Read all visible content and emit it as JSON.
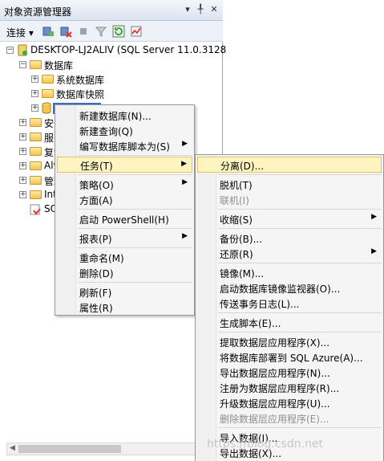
{
  "panel": {
    "title": "对象资源管理器",
    "pin": "▾ ╀",
    "close": "✕"
  },
  "toolbar": {
    "connect_label": "连接"
  },
  "tree": {
    "root": "DESKTOP-LJ2ALIV (SQL Server 11.0.3128",
    "databases": "数据库",
    "system_databases": "系统数据库",
    "db_snapshots": "数据库快照",
    "selected_db": "",
    "security": "安全",
    "server_objects": "服务",
    "replication": "复制",
    "alwayson": "Alw",
    "management": "管理",
    "integration": "Int",
    "sql_agent": "SQ"
  },
  "context_menu": [
    {
      "label": "新建数据库(N)...",
      "arrow": ""
    },
    {
      "label": "新建查询(Q)",
      "arrow": ""
    },
    {
      "label": "编写数据库脚本为(S)",
      "arrow": "▶"
    },
    {
      "label": "任务(T)",
      "arrow": "▶"
    },
    {
      "label": "策略(O)",
      "arrow": "▶"
    },
    {
      "label": "方面(A)",
      "arrow": ""
    },
    {
      "label": "启动 PowerShell(H)",
      "arrow": ""
    },
    {
      "label": "报表(P)",
      "arrow": "▶"
    },
    {
      "label": "重命名(M)",
      "arrow": ""
    },
    {
      "label": "删除(D)",
      "arrow": ""
    },
    {
      "label": "刷新(F)",
      "arrow": ""
    },
    {
      "label": "属性(R)",
      "arrow": ""
    }
  ],
  "tasks_menu": [
    {
      "label": "分离(D)...",
      "arrow": ""
    },
    {
      "label": "脱机(T)",
      "arrow": ""
    },
    {
      "label": "联机(I)",
      "arrow": ""
    },
    {
      "label": "收缩(S)",
      "arrow": "▶"
    },
    {
      "label": "备份(B)...",
      "arrow": ""
    },
    {
      "label": "还原(R)",
      "arrow": "▶"
    },
    {
      "label": "镜像(M)...",
      "arrow": ""
    },
    {
      "label": "启动数据库镜像监视器(O)...",
      "arrow": ""
    },
    {
      "label": "传送事务日志(L)...",
      "arrow": ""
    },
    {
      "label": "生成脚本(E)...",
      "arrow": ""
    },
    {
      "label": "提取数据层应用程序(X)...",
      "arrow": ""
    },
    {
      "label": "将数据库部署到 SQL Azure(A)...",
      "arrow": ""
    },
    {
      "label": "导出数据层应用程序(N)...",
      "arrow": ""
    },
    {
      "label": "注册为数据层应用程序(R)...",
      "arrow": ""
    },
    {
      "label": "升级数据层应用程序(U)...",
      "arrow": ""
    },
    {
      "label": "删除数据层应用程序(E)...",
      "arrow": ""
    },
    {
      "label": "导入数据(I)...",
      "arrow": ""
    },
    {
      "label": "导出数据(X)...",
      "arrow": ""
    }
  ],
  "watermark": "https://blog.csdn.net"
}
